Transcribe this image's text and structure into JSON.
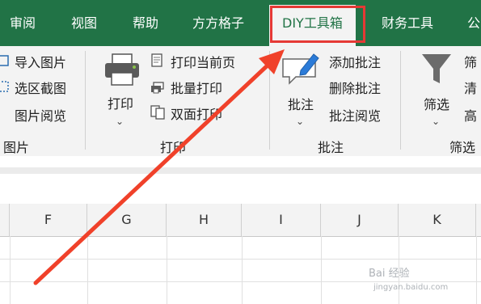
{
  "tabs": [
    {
      "label": "审阅",
      "active": false
    },
    {
      "label": "视图",
      "active": false
    },
    {
      "label": "帮助",
      "active": false
    },
    {
      "label": "方方格子",
      "active": false
    },
    {
      "label": "DIY工具箱",
      "active": true
    },
    {
      "label": "财务工具",
      "active": false
    },
    {
      "label": "公",
      "active": false
    }
  ],
  "ribbon": {
    "picture_group": {
      "items": [
        "导入图片",
        "选区截图",
        "图片阅览"
      ],
      "label": "图片"
    },
    "print_group": {
      "big_button": "打印",
      "items": [
        "打印当前页",
        "批量打印",
        "双面打印"
      ],
      "label": "打印"
    },
    "comment_group": {
      "big_button": "批注",
      "items": [
        "添加批注",
        "删除批注",
        "批注阅览"
      ],
      "label": "批注"
    },
    "filter_group": {
      "big_button": "筛选",
      "items": [
        "筛",
        "清",
        "高"
      ],
      "label": "筛选"
    }
  },
  "columns": [
    "F",
    "G",
    "H",
    "I",
    "J",
    "K"
  ],
  "watermark": {
    "text": "Bai 经验",
    "sub": "jingyan.baidu.com"
  },
  "colors": {
    "tab_bar": "#217346",
    "highlight": "#e53935",
    "ribbon_bg": "#f3f3f3"
  },
  "icons": [
    "printer-icon",
    "pencil-comment-icon",
    "funnel-icon"
  ]
}
